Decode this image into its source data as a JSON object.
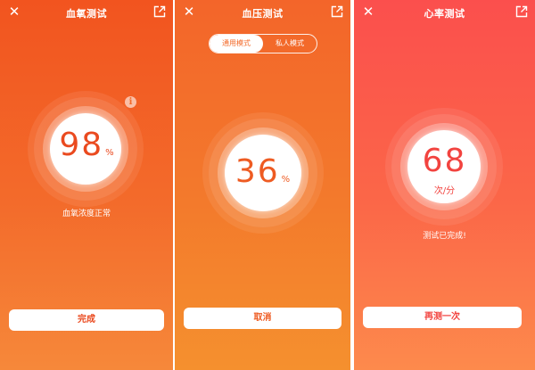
{
  "colors": {
    "oxygen_accent": "#ea4a1f",
    "bp_accent": "#ee5b22",
    "hr_accent": "#f2433f"
  },
  "icons": {
    "close": "close-icon",
    "share": "share-icon",
    "info": "info-icon"
  },
  "oxygen": {
    "title": "血氧测试",
    "value": "98",
    "unit": "%",
    "status": "血氧浓度正常",
    "info_glyph": "i",
    "button_label": "完成"
  },
  "bp": {
    "title": "血压测试",
    "modes": [
      "通用模式",
      "私人模式"
    ],
    "value": "36",
    "unit": "%",
    "button_label": "取消"
  },
  "hr": {
    "title": "心率测试",
    "value": "68",
    "unit": "次/分",
    "status": "测试已完成!",
    "button_label": "再测一次"
  }
}
